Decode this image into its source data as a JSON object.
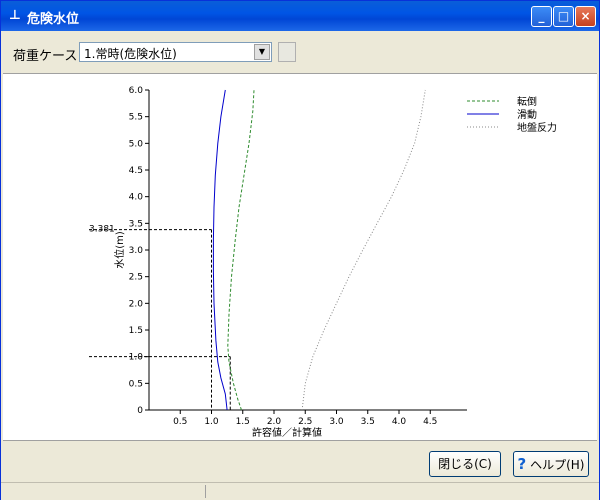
{
  "window": {
    "title": "危険水位",
    "controls": {
      "minimize": "_",
      "maximize": "□",
      "close": "×"
    }
  },
  "toolbar": {
    "case_label": "荷重ケース",
    "case_value": "1.常時(危険水位)"
  },
  "buttons": {
    "close_label": "閉じる(C)",
    "help_label": "ヘルプ(H)",
    "help_icon": "question-icon"
  },
  "chart_data": {
    "type": "line",
    "xlabel": "許容値／計算値",
    "ylabel": "水位(m)",
    "xlim": [
      0,
      4.8
    ],
    "ylim": [
      0,
      6.0
    ],
    "x_ticks": [
      "0.5",
      "1.0",
      "1.5",
      "2.0",
      "2.5",
      "3.0",
      "3.5",
      "4.0",
      "4.5"
    ],
    "y_ticks": [
      "0",
      "0.5",
      "1.0",
      "1.5",
      "2.0",
      "2.5",
      "3.0",
      "3.5",
      "4.0",
      "4.5",
      "5.0",
      "5.5",
      "6.0"
    ],
    "annotation": "3.381",
    "reference_lines": [
      {
        "y": 3.381,
        "x": 1.0
      },
      {
        "y": 1.0,
        "x": 1.3
      }
    ],
    "series": [
      {
        "name": "転倒",
        "color": "#2e8b2e",
        "dash": "3,2",
        "points": [
          [
            1.48,
            0
          ],
          [
            1.42,
            0.2
          ],
          [
            1.35,
            0.5
          ],
          [
            1.28,
            0.9
          ],
          [
            1.26,
            1.2
          ],
          [
            1.28,
            1.8
          ],
          [
            1.32,
            2.5
          ],
          [
            1.38,
            3.2
          ],
          [
            1.44,
            3.8
          ],
          [
            1.52,
            4.4
          ],
          [
            1.6,
            5.0
          ],
          [
            1.66,
            5.6
          ],
          [
            1.68,
            6.0
          ]
        ]
      },
      {
        "name": "滑動",
        "color": "#0000cc",
        "dash": "",
        "points": [
          [
            1.25,
            0
          ],
          [
            1.22,
            0.3
          ],
          [
            1.15,
            0.6
          ],
          [
            1.1,
            0.9
          ],
          [
            1.07,
            1.3
          ],
          [
            1.04,
            2.0
          ],
          [
            1.03,
            2.6
          ],
          [
            1.03,
            3.2
          ],
          [
            1.04,
            3.8
          ],
          [
            1.06,
            4.4
          ],
          [
            1.1,
            5.0
          ],
          [
            1.15,
            5.5
          ],
          [
            1.22,
            6.0
          ]
        ]
      },
      {
        "name": "地盤反力",
        "color": "#888888",
        "dash": "1,2",
        "points": [
          [
            2.45,
            0
          ],
          [
            2.5,
            0.5
          ],
          [
            2.62,
            1.0
          ],
          [
            2.8,
            1.5
          ],
          [
            3.0,
            2.0
          ],
          [
            3.2,
            2.5
          ],
          [
            3.42,
            3.0
          ],
          [
            3.65,
            3.5
          ],
          [
            3.88,
            4.0
          ],
          [
            4.08,
            4.5
          ],
          [
            4.25,
            5.0
          ],
          [
            4.35,
            5.5
          ],
          [
            4.42,
            6.0
          ]
        ]
      }
    ],
    "legend_position": "top-right",
    "grid": false
  }
}
